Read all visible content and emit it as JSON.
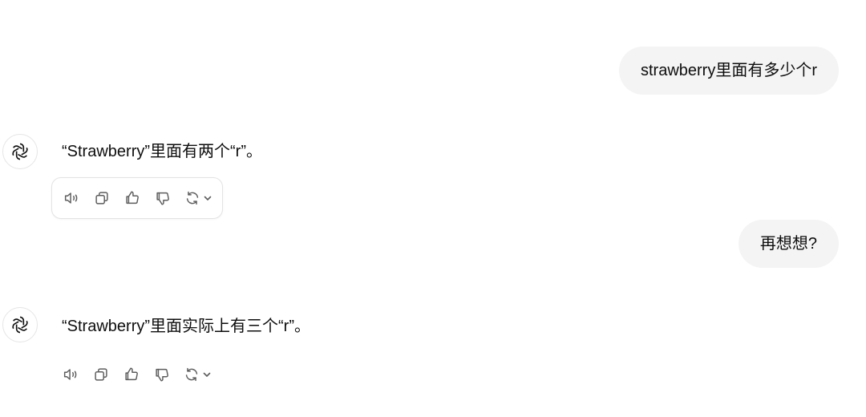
{
  "conversation": {
    "user_messages": [
      {
        "text": "strawberry里面有多少个r"
      },
      {
        "text": "再想想?"
      }
    ],
    "assistant_messages": [
      {
        "text": "“Strawberry”里面有两个“r”。"
      },
      {
        "text": "“Strawberry”里面实际上有三个“r”。"
      }
    ]
  },
  "icons": {
    "avatar": "openai-logo-icon",
    "actions": [
      "read-aloud-icon",
      "copy-icon",
      "thumbs-up-icon",
      "thumbs-down-icon",
      "regenerate-icon",
      "chevron-down-icon"
    ]
  },
  "colors": {
    "user_bubble_bg": "#f4f4f4",
    "text": "#0d0d0d",
    "icon": "#5d5d5d",
    "border": "#e3e3e3"
  }
}
